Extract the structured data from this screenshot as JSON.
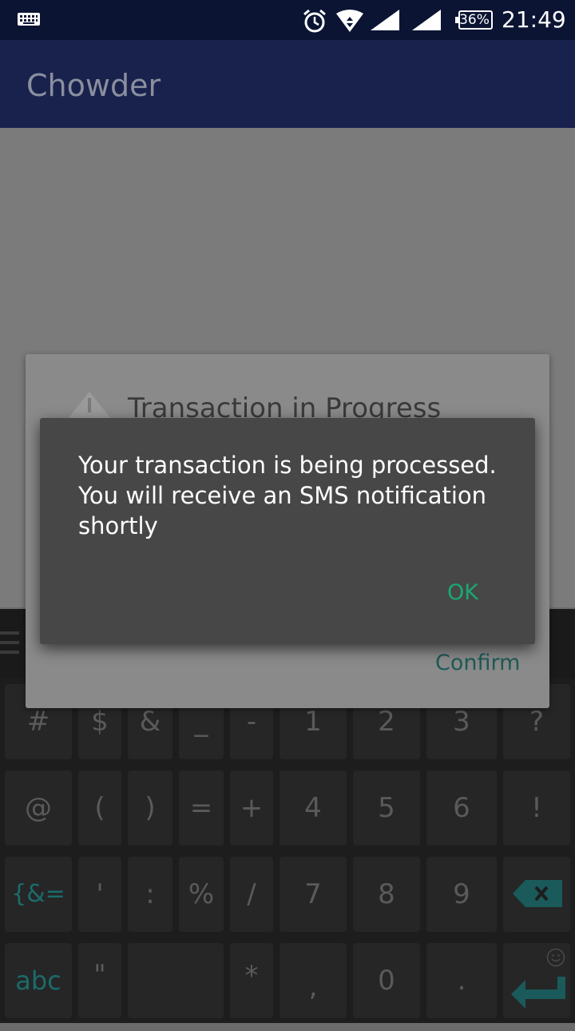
{
  "status_bar": {
    "battery": "36%",
    "time": "21:49",
    "icons": [
      "keyboard-icon",
      "alarm-icon",
      "wifi-icon",
      "cell-signal-icon",
      "cell-signal-icon",
      "battery-icon"
    ]
  },
  "app_bar": {
    "title": "Chowder"
  },
  "background_dialog": {
    "title": "Transaction in Progress",
    "confirm_label": "Confirm"
  },
  "dialog": {
    "message": "Your transaction is being processed. You will receive an SMS notification shortly",
    "ok_label": "OK"
  },
  "keyboard": {
    "row1": [
      "#",
      "$",
      "&",
      "_",
      "-",
      "1",
      "2",
      "3",
      "?"
    ],
    "row2": [
      "@",
      "(",
      ")",
      "=",
      "+",
      "4",
      "5",
      "6",
      "!"
    ],
    "row3": [
      "{&=",
      "'",
      ":",
      "%",
      "/",
      "7",
      "8",
      "9"
    ],
    "row4": [
      "abc",
      "\"",
      "",
      "*",
      ",",
      "0",
      "."
    ]
  },
  "colors": {
    "status_bar": "#0b1433",
    "app_bar": "#19214d",
    "dialog": "#474747",
    "ok_accent": "#19a974"
  }
}
